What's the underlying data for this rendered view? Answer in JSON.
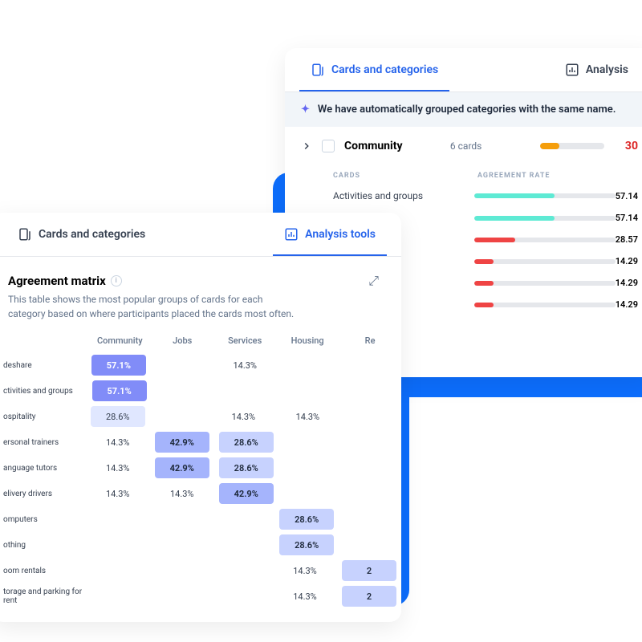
{
  "tabs": {
    "cards": "Cards and categories",
    "analysis": "Analysis",
    "analysis_tools": "Analysis tools"
  },
  "back": {
    "banner": "We have automatically grouped categories with the same name.",
    "group": {
      "name": "Community",
      "count": "6 cards",
      "pct": "30",
      "fill": 30
    },
    "sub": {
      "cards": "CARDS",
      "agree": "AGREEMENT RATE"
    },
    "rows": [
      {
        "label": "Activities and groups",
        "val": "57.14",
        "fill": 57,
        "color": "teal"
      },
      {
        "label": "",
        "val": "57.14",
        "fill": 57,
        "color": "teal"
      },
      {
        "label": "",
        "val": "28.57",
        "fill": 29,
        "color": "red"
      },
      {
        "label": "",
        "val": "14.29",
        "fill": 14,
        "color": "red"
      },
      {
        "label": "",
        "val": "14.29",
        "fill": 14,
        "color": "red"
      },
      {
        "label": "",
        "val": "14.29",
        "fill": 14,
        "color": "red"
      }
    ]
  },
  "front": {
    "title": "Agreement matrix",
    "desc": "This table shows the most popular groups of cards for each category based on where participants placed the cards most often.",
    "cols": [
      "Community",
      "Jobs",
      "Services",
      "Housing",
      "Re"
    ],
    "rows": [
      {
        "label": "deshare",
        "cells": [
          "57.1%|4",
          "",
          "14.3%|0",
          "",
          ""
        ]
      },
      {
        "label": "ctivities and groups",
        "cells": [
          "57.1%|4",
          "",
          "",
          "",
          ""
        ]
      },
      {
        "label": "ospitality",
        "cells": [
          "28.6%|1",
          "",
          "14.3%|0",
          "14.3%|0",
          ""
        ]
      },
      {
        "label": "ersonal trainers",
        "cells": [
          "14.3%|0",
          "42.9%|3",
          "28.6%|2",
          "",
          ""
        ]
      },
      {
        "label": "anguage tutors",
        "cells": [
          "14.3%|0",
          "42.9%|3",
          "28.6%|2",
          "",
          ""
        ]
      },
      {
        "label": "elivery drivers",
        "cells": [
          "14.3%|0",
          "14.3%|0",
          "42.9%|3",
          "",
          ""
        ]
      },
      {
        "label": "omputers",
        "cells": [
          "",
          "",
          "",
          "28.6%|2",
          ""
        ]
      },
      {
        "label": "othing",
        "cells": [
          "",
          "",
          "",
          "28.6%|2",
          ""
        ]
      },
      {
        "label": "oom rentals",
        "cells": [
          "",
          "",
          "",
          "14.3%|0",
          "2|2"
        ]
      },
      {
        "label": "torage and parking for rent",
        "cells": [
          "",
          "",
          "",
          "14.3%|0",
          "2|2"
        ]
      }
    ]
  }
}
